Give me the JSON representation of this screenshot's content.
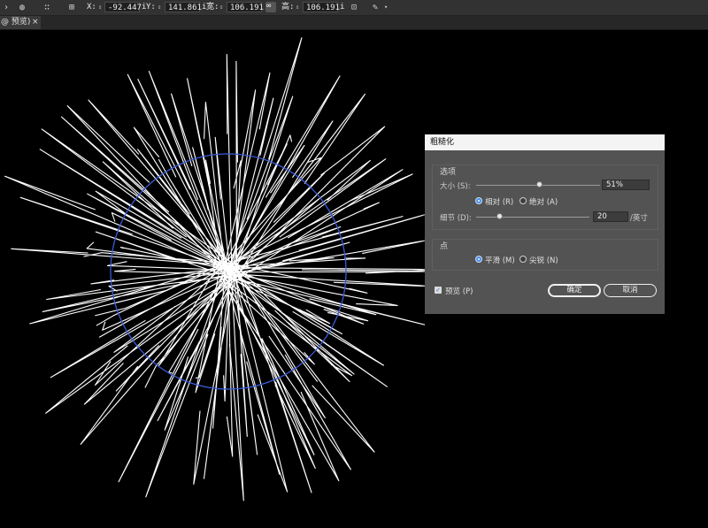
{
  "toolbar": {
    "x_label": "X:",
    "x_value": "-92.447",
    "y_label": "Y:",
    "y_value": "141.861",
    "w_label": "宽:",
    "w_value": "106.191",
    "h_label": "高:",
    "h_value": "106.191",
    "unit": "i"
  },
  "tab": {
    "title": "@ 预览)",
    "close": "×"
  },
  "dialog": {
    "title": "粗糙化",
    "options_group": {
      "label": "选项",
      "size_label": "大小 (S):",
      "size_value": "51%",
      "size_fraction": 0.51,
      "relative_label": "相对 (R)",
      "absolute_label": "绝对 (A)",
      "selected_mode": "relative",
      "detail_label": "细节 (D):",
      "detail_value": "20",
      "detail_fraction": 0.2,
      "detail_unit": "/英寸"
    },
    "points_group": {
      "label": "点",
      "smooth_label": "平滑 (M)",
      "corner_label": "尖锐 (N)",
      "selected": "smooth"
    },
    "preview_label": "预览 (P)",
    "preview_checked": true,
    "ok_label": "确定",
    "cancel_label": "取消"
  },
  "colors": {
    "guide_circle": "#3b5bd6",
    "strokes": "#ffffff",
    "canvas": "#000000",
    "accent": "#4a90f0"
  }
}
